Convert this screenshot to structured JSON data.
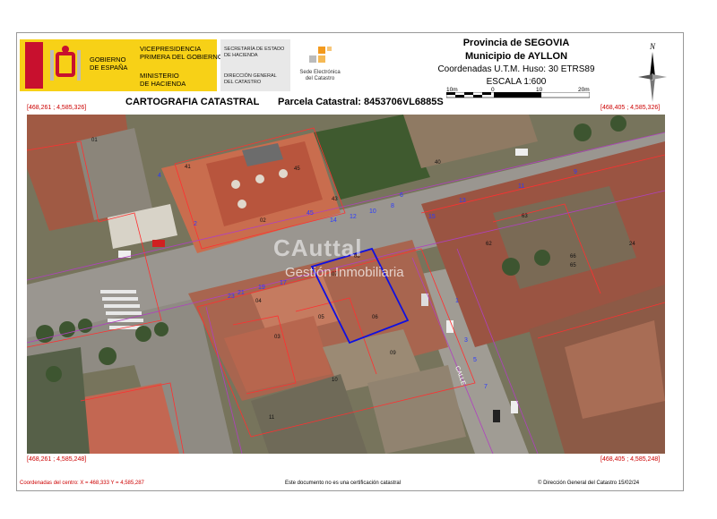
{
  "header": {
    "gobierno": [
      "GOBIERNO",
      "DE ESPAÑA"
    ],
    "vicepresidencia": [
      "VICEPRESIDENCIA",
      "PRIMERA DEL GOBIERNO"
    ],
    "ministerio": [
      "MINISTERIO",
      "DE HACIENDA"
    ],
    "secretaria": [
      "SECRETARÍA DE ESTADO",
      "DE HACIENDA"
    ],
    "direccion": [
      "DIRECCIÓN GENERAL",
      "DEL CATASTRO"
    ],
    "sede": [
      "Sede Electrónica",
      "del Catastro"
    ],
    "provincia": "Provincia de SEGOVIA",
    "municipio": "Municipio de AYLLON",
    "coordenadas": "Coordenadas U.T.M. Huso: 30 ETRS89",
    "escala": "ESCALA 1:600",
    "scale_ticks": [
      "10m",
      "0",
      "10",
      "20m"
    ],
    "north": "N",
    "cartografia": "CARTOGRAFIA CATASTRAL",
    "parcela": "Parcela Catastral: 8453706VL6885S"
  },
  "corners": {
    "tl": "[468,261 ; 4,585,326]",
    "tr": "[468,405 ; 4,585,326]",
    "bl": "[468,261 ; 4,585,248]",
    "br": "[468,405 ; 4,585,248]"
  },
  "map": {
    "watermark_1": "CAuttal",
    "watermark_2": "Gestión Inmobiliaria",
    "street_numbers": [
      "21",
      "23",
      "19",
      "17",
      "15",
      "13",
      "11",
      "9",
      "14",
      "12",
      "10",
      "8",
      "6",
      "4",
      "2",
      "3",
      "5",
      "7",
      "1",
      "45"
    ],
    "parcel_labels": [
      "01",
      "02",
      "03",
      "04",
      "05",
      "06",
      "07",
      "08",
      "09",
      "10",
      "11",
      "62",
      "63",
      "65",
      "66",
      "24",
      "40",
      "41",
      "43",
      "45"
    ],
    "street_name": "CALLE"
  },
  "footer": {
    "center_coords": "Coordenadas del centro: X = 468,333 Y = 4,585,287",
    "no_cert": "Este documento no es una certificación catastral",
    "copyright": "© Dirección General del Catastro 15/02/24"
  },
  "colors": {
    "gob_yellow": "#f7d117",
    "red_coord": "#cc0000",
    "parcel_line": "#0000cc",
    "roof_red": "#b8553d"
  }
}
